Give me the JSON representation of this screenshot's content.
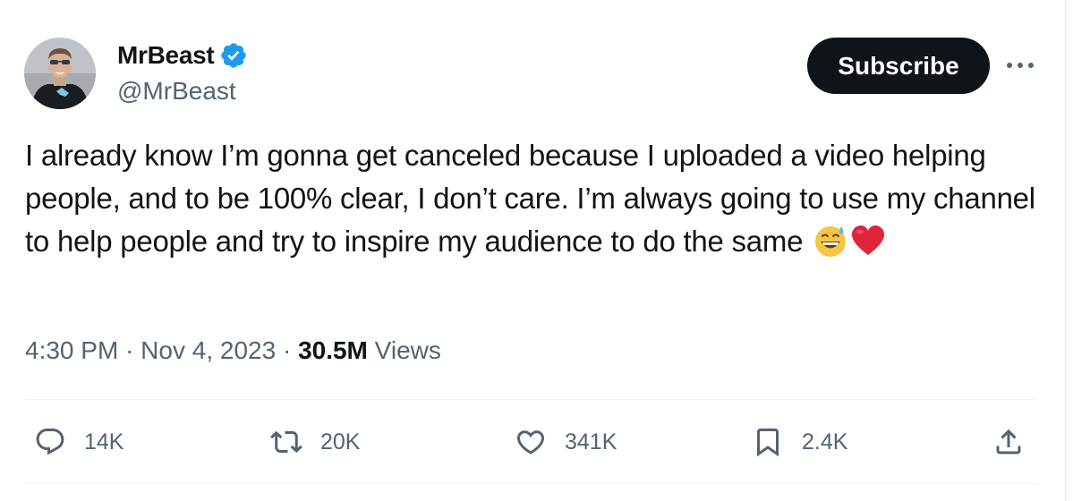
{
  "author": {
    "display_name": "MrBeast",
    "handle": "@MrBeast",
    "verified_icon": "verified-badge-icon"
  },
  "header": {
    "subscribe_label": "Subscribe",
    "more_icon": "more-horizontal-icon"
  },
  "tweet": {
    "text": "I already know I’m gonna get canceled because I uploaded a video helping people, and to be 100% clear, I don’t care. I’m always going to use my channel to help people and try to inspire my audience to do the same",
    "emojis": [
      "grinning-sweat-emoji",
      "red-heart-emoji"
    ]
  },
  "meta": {
    "time": "4:30 PM",
    "separator": "·",
    "date": "Nov 4, 2023",
    "views_count": "30.5M",
    "views_label": "Views"
  },
  "actions": {
    "reply_count": "14K",
    "repost_count": "20K",
    "like_count": "341K",
    "bookmark_count": "2.4K",
    "icons": [
      "reply-icon",
      "repost-icon",
      "like-icon",
      "bookmark-icon",
      "share-icon"
    ]
  },
  "colors": {
    "text_primary": "#0f1419",
    "text_secondary": "#536471",
    "verified_blue": "#1d9bf0",
    "button_bg": "#0f1419",
    "divider": "#eff3f4"
  }
}
